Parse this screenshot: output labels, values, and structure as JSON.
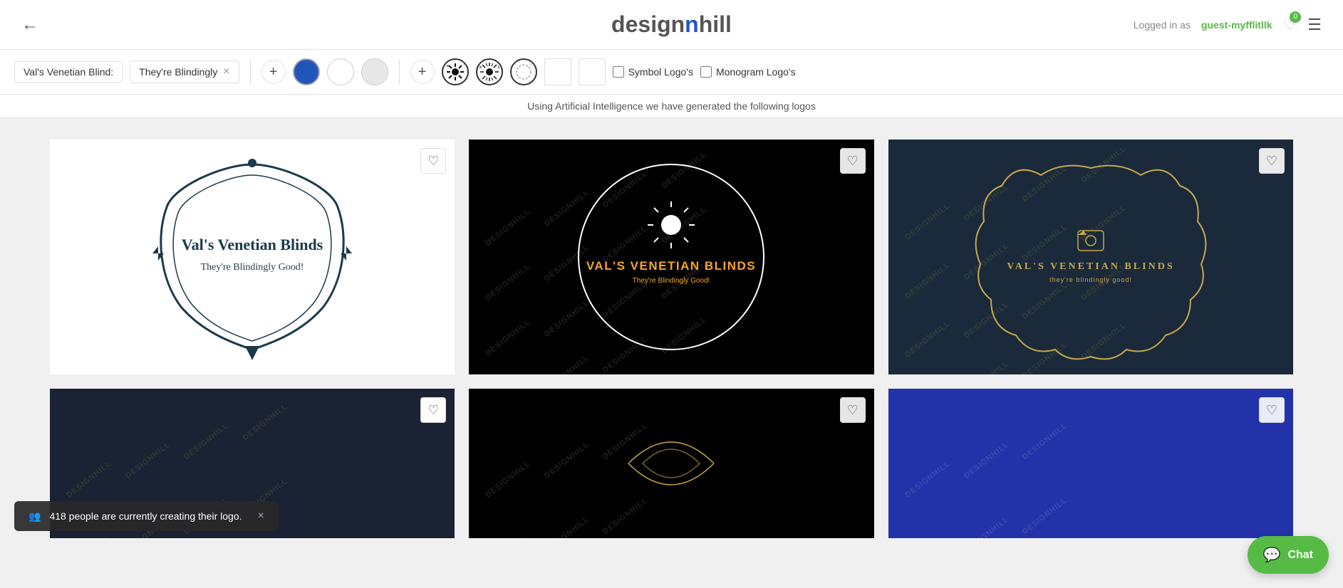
{
  "header": {
    "back_label": "←",
    "logo_design": "design",
    "logo_n": "n",
    "logo_hill": "hill",
    "logged_in_text": "Logged in as",
    "username": "guest-myfflitllk",
    "heart_count": "0",
    "menu_label": "☰"
  },
  "toolbar": {
    "tag1_label": "Val's Venetian Blind:",
    "tag2_label": "They're Blindingly",
    "tag2_close": "×",
    "add1_label": "+",
    "add2_label": "+",
    "color1": "#2255bb",
    "color2": "#ffffff",
    "color3": "#dddddd",
    "swatch_empty1": "",
    "swatch_empty2": "",
    "symbol_logos_label": "Symbol Logo's",
    "monogram_logos_label": "Monogram Logo's"
  },
  "ai_text": "Using Artificial Intelligence we have generated the following logos",
  "logos": [
    {
      "id": 1,
      "bg": "white",
      "title": "Val's Venetian Blinds",
      "subtitle": "They're Blindingly Good!",
      "style": "badge"
    },
    {
      "id": 2,
      "bg": "black",
      "title": "VAL'S VENETIAN BLINDS",
      "subtitle": "They're Blindingly Good!",
      "style": "sun-circle"
    },
    {
      "id": 3,
      "bg": "dark-blue",
      "title": "VAL'S VENETIAN BLINDS",
      "subtitle": "they're blindingly good!",
      "style": "cloud-frame"
    }
  ],
  "notification": {
    "icon": "👥",
    "text": "418 people are currently creating their logo.",
    "close_label": "×"
  },
  "chat": {
    "icon": "💬",
    "label": "Chat"
  },
  "watermarks": {
    "text": "DESIGNHILL"
  }
}
